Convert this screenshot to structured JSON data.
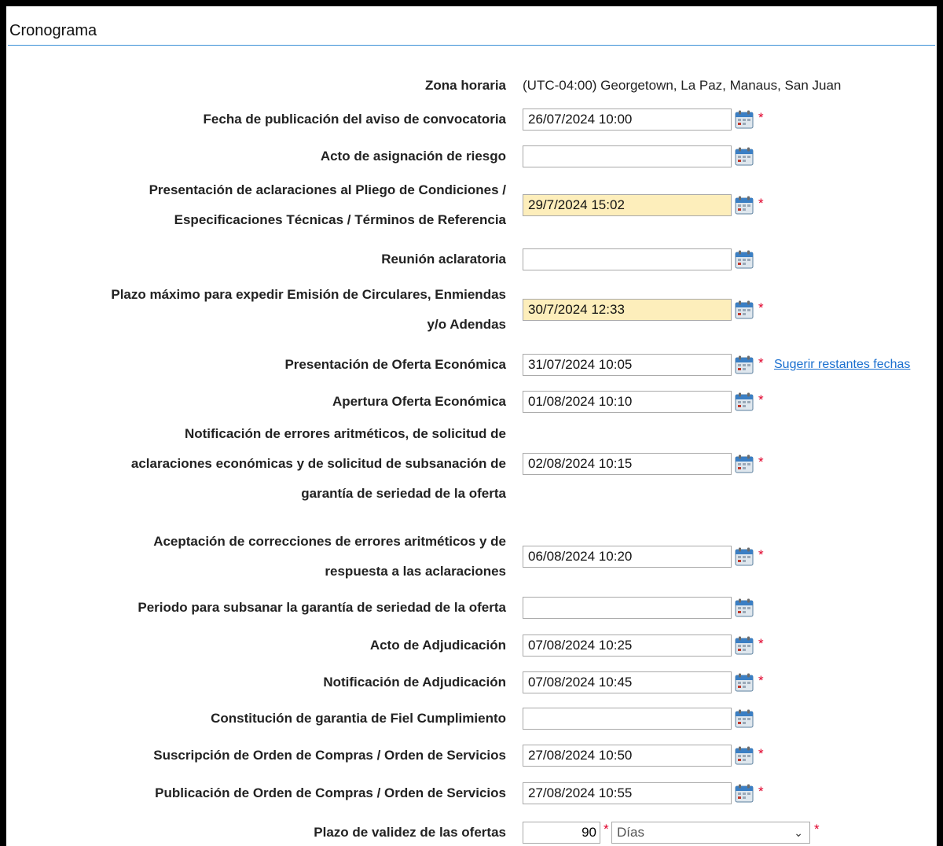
{
  "section": {
    "title": "Cronograma"
  },
  "timezone": {
    "label": "Zona horaria",
    "value": "(UTC-04:00) Georgetown, La Paz, Manaus, San Juan"
  },
  "rows": [
    {
      "label": "Fecha de publicación del aviso de convocatoria",
      "value": "26/07/2024 10:00",
      "required": "*"
    },
    {
      "label": "Acto de asignación de riesgo",
      "value": ""
    },
    {
      "label_lines": [
        "Presentación de aclaraciones al Pliego de Condiciones /",
        "Especificaciones Técnicas / Términos de Referencia"
      ],
      "value": "29/7/2024 15:02",
      "required": "*",
      "highlight": "#fdeebb"
    },
    {
      "label": "Reunión aclaratoria",
      "value": ""
    },
    {
      "label_lines": [
        "Plazo máximo para expedir Emisión de Circulares, Enmiendas",
        "y/o Adendas"
      ],
      "value": "30/7/2024 12:33",
      "required": "*",
      "highlight": "#fdeebb"
    },
    {
      "label": "Presentación de Oferta Económica",
      "value": "31/07/2024 10:05",
      "required": "*",
      "link": "Sugerir restantes fechas"
    },
    {
      "label": "Apertura Oferta Económica",
      "value": "01/08/2024 10:10",
      "required": "*"
    },
    {
      "label_lines": [
        "Notificación de errores aritméticos, de solicitud de",
        "aclaraciones económicas y de solicitud de subsanación de",
        "garantía de seriedad de la oferta"
      ],
      "value": "02/08/2024 10:15",
      "required": "*"
    },
    {
      "label_lines": [
        "Aceptación de correcciones de errores aritméticos y de",
        "respuesta a las aclaraciones"
      ],
      "value": "06/08/2024 10:20",
      "required": "*"
    },
    {
      "label": "Periodo para subsanar la garantía de seriedad de la oferta",
      "value": ""
    },
    {
      "label": "Acto de Adjudicación",
      "value": "07/08/2024 10:25",
      "required": "*"
    },
    {
      "label": "Notificación de Adjudicación",
      "value": "07/08/2024 10:45",
      "required": "*"
    },
    {
      "label": "Constitución de garantia de Fiel Cumplimiento",
      "value": ""
    },
    {
      "label": "Suscripción de Orden de Compras / Orden de Servicios",
      "value": "27/08/2024 10:50",
      "required": "*"
    },
    {
      "label": "Publicación de Orden de Compras / Orden de Servicios",
      "value": "27/08/2024 10:55",
      "required": "*"
    }
  ],
  "validity": {
    "label": "Plazo de validez de las ofertas",
    "number": "90",
    "unit": "Días",
    "required": "*"
  },
  "colors": {
    "accent": "#3a8fd6",
    "highlight": "#fdeebb",
    "required": "#e0002a",
    "link": "#1a6fcf"
  },
  "icons": {
    "calendar": "calendar-icon",
    "select": "chevron-down-icon"
  }
}
